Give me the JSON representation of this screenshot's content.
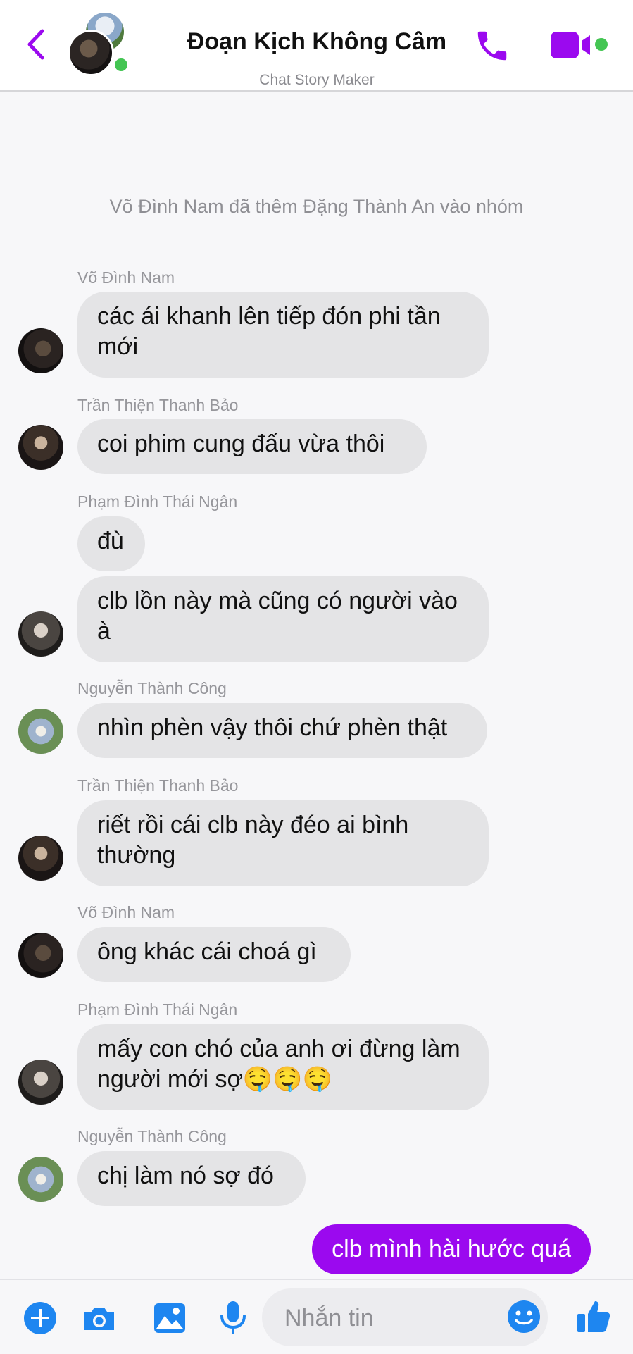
{
  "header": {
    "title": "Đoạn Kịch Không Câm",
    "subtitle": "Chat Story Maker",
    "accent_color": "#9b09ef",
    "online_color": "#44c553"
  },
  "system_message": "Võ Đình Nam đã thêm Đặng Thành An vào nhóm",
  "messages": [
    {
      "sender": "Võ Đình Nam",
      "texts": [
        "các ái khanh lên tiếp đón phi tần mới"
      ]
    },
    {
      "sender": "Trần Thiện Thanh Bảo",
      "texts": [
        "coi phim cung đấu vừa thôi"
      ]
    },
    {
      "sender": "Phạm Đình Thái Ngân",
      "texts": [
        "đù",
        "clb lồn này mà cũng có người vào à"
      ]
    },
    {
      "sender": "Nguyễn Thành Công",
      "texts": [
        "nhìn phèn vậy thôi chứ phèn thật"
      ]
    },
    {
      "sender": "Trần Thiện Thanh Bảo",
      "texts": [
        "riết rồi cái clb này đéo ai bình thường"
      ]
    },
    {
      "sender": "Võ Đình Nam",
      "texts": [
        "ông khác cái choá gì"
      ]
    },
    {
      "sender": "Phạm Đình Thái Ngân",
      "texts": [
        "mấy con chó của anh ơi đừng làm người mới sợ🤤🤤🤤"
      ]
    },
    {
      "sender": "Nguyễn Thành Công",
      "texts": [
        "chị làm nó sợ đó"
      ]
    }
  ],
  "own_message": "clb mình hài hước quá",
  "composer": {
    "placeholder": "Nhắn tin",
    "icons": [
      "plus-icon",
      "camera-icon",
      "image-icon",
      "microphone-icon",
      "emoji-icon",
      "thumbs-up-icon"
    ]
  }
}
